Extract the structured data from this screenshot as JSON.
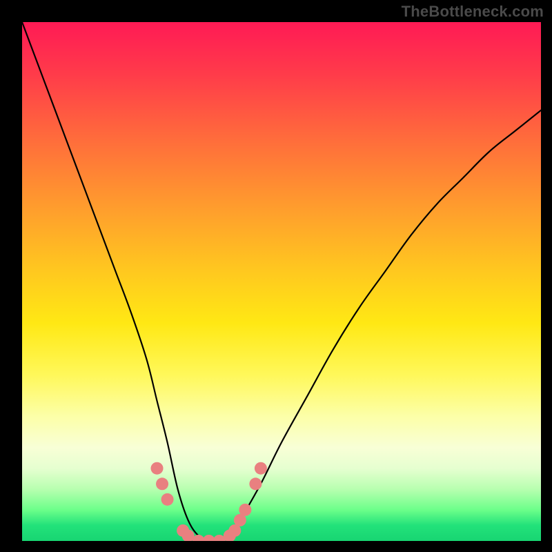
{
  "watermark": "TheBottleneck.com",
  "colors": {
    "frame_background": "#000000",
    "curve_stroke": "#000000",
    "dot_fill": "#e98080",
    "gradient_top": "#ff1a55",
    "gradient_bottom": "#18d572",
    "watermark_text": "#4a4a4a"
  },
  "chart_data": {
    "type": "line",
    "title": "",
    "xlabel": "",
    "ylabel": "",
    "xlim": [
      0,
      100
    ],
    "ylim": [
      0,
      100
    ],
    "grid": false,
    "legend": false,
    "series": [
      {
        "name": "penalty-curve",
        "x": [
          0,
          3,
          6,
          9,
          12,
          15,
          18,
          21,
          24,
          26,
          28,
          30,
          32,
          34,
          36,
          38,
          40,
          42,
          46,
          50,
          55,
          60,
          65,
          70,
          75,
          80,
          85,
          90,
          95,
          100
        ],
        "y": [
          100,
          92,
          84,
          76,
          68,
          60,
          52,
          44,
          35,
          27,
          19,
          10,
          4,
          1,
          0,
          0,
          1,
          4,
          11,
          19,
          28,
          37,
          45,
          52,
          59,
          65,
          70,
          75,
          79,
          83
        ]
      }
    ],
    "dots": {
      "name": "highlight-dots",
      "points": [
        {
          "x": 26,
          "y": 14
        },
        {
          "x": 27,
          "y": 11
        },
        {
          "x": 28,
          "y": 8
        },
        {
          "x": 31,
          "y": 2
        },
        {
          "x": 32,
          "y": 1
        },
        {
          "x": 34,
          "y": 0
        },
        {
          "x": 36,
          "y": 0
        },
        {
          "x": 38,
          "y": 0
        },
        {
          "x": 40,
          "y": 1
        },
        {
          "x": 41,
          "y": 2
        },
        {
          "x": 42,
          "y": 4
        },
        {
          "x": 43,
          "y": 6
        },
        {
          "x": 45,
          "y": 11
        },
        {
          "x": 46,
          "y": 14
        }
      ],
      "radius_pct": 1.2
    }
  }
}
